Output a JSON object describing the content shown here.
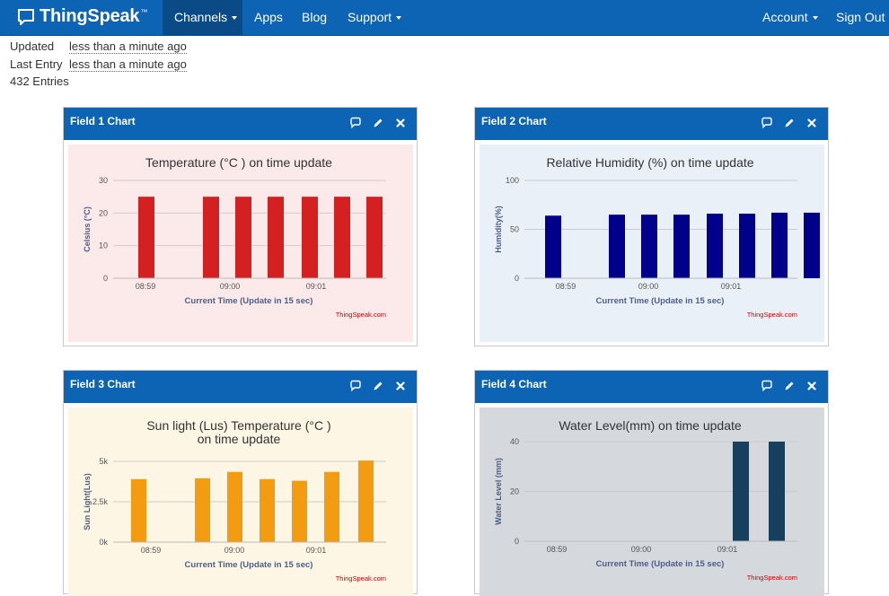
{
  "navbar": {
    "brand": "ThingSpeak",
    "trademark": "™",
    "items": [
      {
        "label": "Channels",
        "dropdown": true,
        "active": true
      },
      {
        "label": "Apps",
        "dropdown": false,
        "active": false
      },
      {
        "label": "Blog",
        "dropdown": false,
        "active": false
      },
      {
        "label": "Support",
        "dropdown": true,
        "active": false
      }
    ],
    "right_items": [
      {
        "label": "Account",
        "dropdown": true
      },
      {
        "label": "Sign Out",
        "dropdown": false
      }
    ],
    "colors": {
      "bar": "#0d63b4",
      "active": "#0a4a86"
    }
  },
  "channel_info": {
    "updated_label": "Updated",
    "updated_value": "less than a minute ago",
    "last_entry_label": "Last Entry",
    "last_entry_value": "less than a minute ago",
    "entries": "432 Entries"
  },
  "panel_icons": [
    "comment-icon",
    "pencil-icon",
    "close-icon"
  ],
  "panels": [
    {
      "title": "Field 1 Chart",
      "bg": "#fceaea",
      "bar_color": "#d42020",
      "chart_data": {
        "type": "bar",
        "title": "Temperature (°C ) on time update",
        "ylabel": "Celsius (°C)",
        "xlabel": "Current Time (Update in 15 sec)",
        "credit": "ThingSpeak.com",
        "ylim": [
          0,
          30
        ],
        "yticks": [
          "0",
          "10",
          "20",
          "30"
        ],
        "xticks": [
          "08:59",
          "09:00",
          "09:01"
        ],
        "values": [
          25,
          25,
          25,
          25,
          25,
          25,
          25
        ],
        "grid": true
      }
    },
    {
      "title": "Field 2 Chart",
      "bg": "#eaf0f7",
      "bar_color": "#00008b",
      "chart_data": {
        "type": "bar",
        "title": "Relative Humidity (%) on time update",
        "ylabel": "Humidity(%)",
        "xlabel": "Current Time (Update in 15 sec)",
        "credit": "ThingSpeak.com",
        "ylim": [
          0,
          100
        ],
        "yticks": [
          "0",
          "50",
          "100"
        ],
        "xticks": [
          "08:59",
          "09:00",
          "09:01"
        ],
        "values": [
          64,
          65,
          65,
          65,
          66,
          66,
          67,
          67
        ],
        "grid": true
      }
    },
    {
      "title": "Field 3 Chart",
      "bg": "#fdf6e4",
      "bar_color": "#f39c12",
      "chart_data": {
        "type": "bar",
        "title": "Sun light (Lus) Temperature (°C ) on time update",
        "ylabel": "Sun Light(Lus)",
        "xlabel": "Current Time (Update in 15 sec)",
        "credit": "ThingSpeak.com",
        "ylim": [
          0,
          5000
        ],
        "yticks": [
          "0k",
          "2.5k",
          "5k"
        ],
        "xticks": [
          "08:59",
          "09:00",
          "09:01"
        ],
        "values": [
          3900,
          3950,
          4350,
          3900,
          3800,
          4350,
          5050
        ],
        "grid": true
      }
    },
    {
      "title": "Field 4 Chart",
      "bg": "#d5d8dc",
      "bar_color": "#17405e",
      "chart_data": {
        "type": "bar",
        "title": "Water Level(mm) on time update",
        "ylabel": "Water Level (mm)",
        "xlabel": "Current Time (Update in 15 sec)",
        "credit": "ThingSpeak.com",
        "ylim": [
          0,
          40
        ],
        "yticks": [
          "0",
          "20",
          "40"
        ],
        "xticks": [
          "08:59",
          "09:00",
          "09:01"
        ],
        "values": [
          40,
          40
        ],
        "grid": true
      }
    }
  ]
}
